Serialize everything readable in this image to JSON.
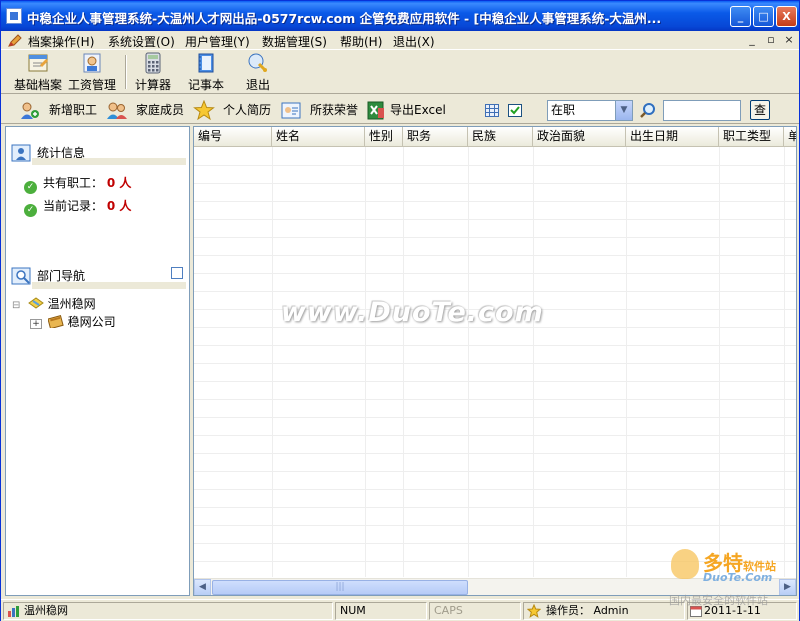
{
  "window": {
    "title": "中稳企业人事管理系统-大温州人才网出品-0577rcw.com 企管免费应用软件 - [中稳企业人事管理系统-大温州...",
    "min_label": "_",
    "max_label": "□",
    "close_label": "X"
  },
  "menu": {
    "items": [
      {
        "label": "档案操作(H)"
      },
      {
        "label": "系统设置(O)"
      },
      {
        "label": "用户管理(Y)"
      },
      {
        "label": "数据管理(S)"
      },
      {
        "label": "帮助(H)"
      },
      {
        "label": "退出(X)"
      }
    ],
    "mdi_min": "_",
    "mdi_restore": "▫",
    "mdi_close": "×"
  },
  "toolbar1": {
    "buttons": [
      {
        "label": "基础档案",
        "icon": "archive-icon"
      },
      {
        "label": "工资管理",
        "icon": "salary-icon"
      },
      {
        "label": "计算器",
        "icon": "calculator-icon"
      },
      {
        "label": "记事本",
        "icon": "notebook-icon"
      },
      {
        "label": "退出",
        "icon": "exit-icon"
      }
    ]
  },
  "toolbar2": {
    "buttons": [
      {
        "label": "新增职工",
        "icon": "add-employee-icon"
      },
      {
        "label": "家庭成员",
        "icon": "family-icon"
      },
      {
        "label": "个人简历",
        "icon": "star-icon"
      },
      {
        "label": "所获荣誉",
        "icon": "honor-icon"
      },
      {
        "label": "导出Excel",
        "icon": "excel-icon"
      }
    ],
    "status_filter": "在职",
    "search_placeholder": "",
    "search_button": "查"
  },
  "left_panel": {
    "stats_title": "统计信息",
    "total_label": "共有职工：",
    "total_value": "0 人",
    "current_label": "当前记录：",
    "current_value": "0 人",
    "dept_title": "部门导航",
    "tree": {
      "root": "温州稳网",
      "child": "稳网公司"
    }
  },
  "grid": {
    "columns": [
      "编号",
      "姓名",
      "性别",
      "职务",
      "民族",
      "政治面貌",
      "出生日期",
      "职工类型",
      "单"
    ]
  },
  "watermark": {
    "main": "www.DuoTe.com",
    "logo_title": "多特",
    "logo_sub": "软件站",
    "logo_url": "DuoTe.Com"
  },
  "statusbar": {
    "company": "温州稳网",
    "num": "NUM",
    "caps": "CAPS",
    "operator": "操作员：  Admin",
    "date": "2011-1-11",
    "tag": "国内最安全的软件站"
  },
  "colors": {
    "titlebar": "#0a5ae8",
    "value_red": "#c00000",
    "watermark_orange": "#f5a623"
  }
}
